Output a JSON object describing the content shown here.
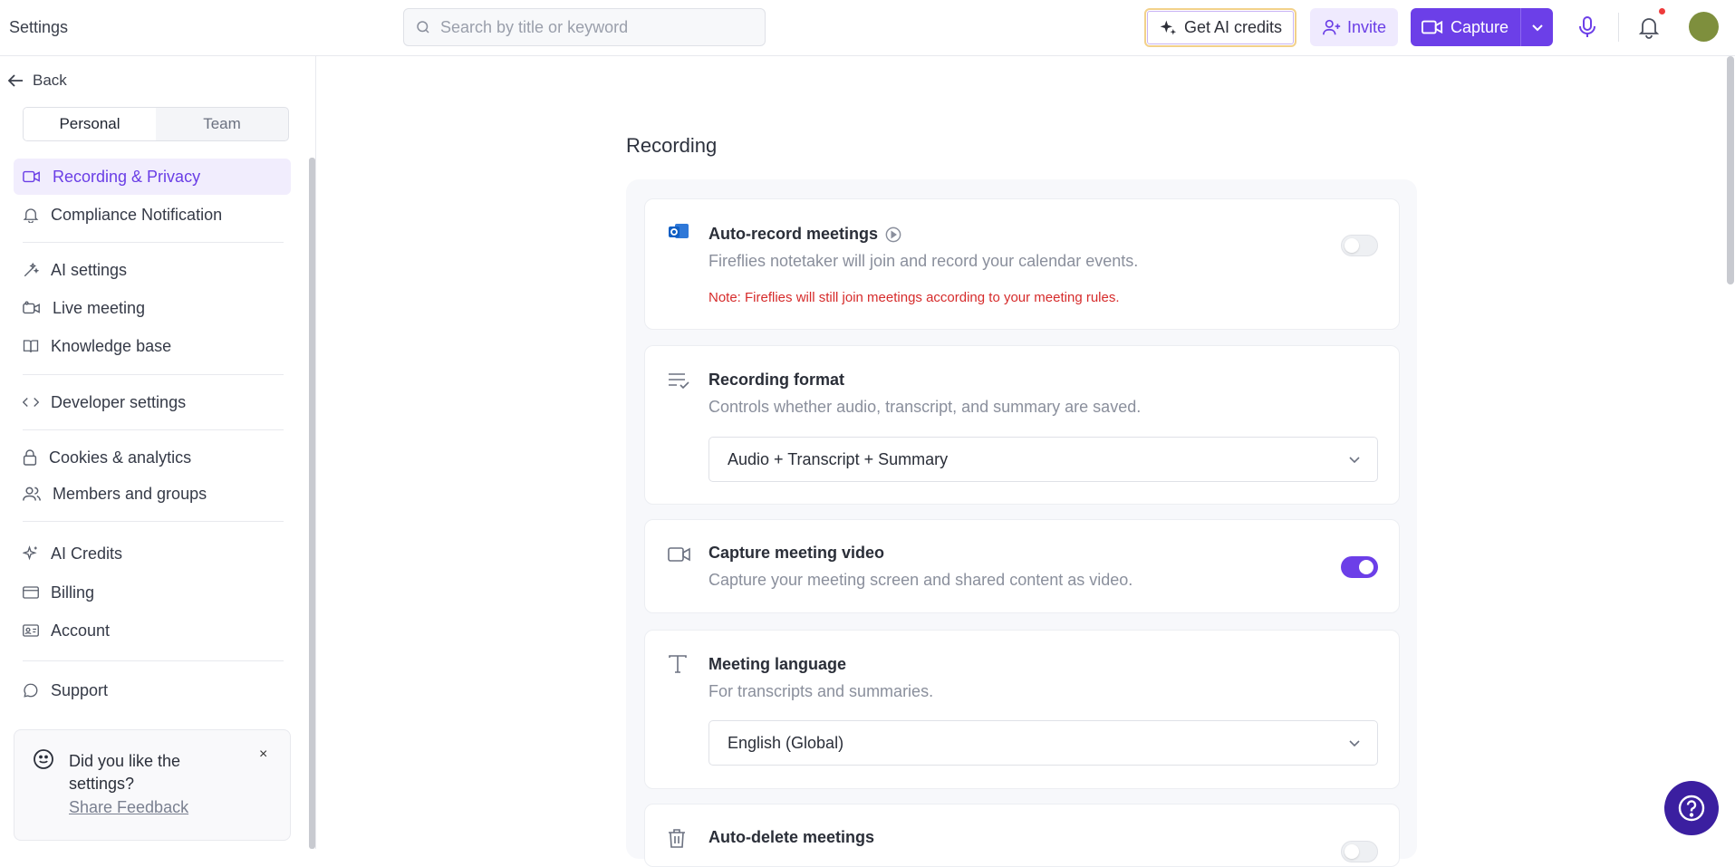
{
  "app": {
    "title": "Settings"
  },
  "search": {
    "placeholder": "Search by title or keyword"
  },
  "header": {
    "get_credits_label": "Get AI credits",
    "invite_label": "Invite",
    "capture_label": "Capture"
  },
  "sidebar": {
    "back_label": "Back",
    "segments": {
      "personal": "Personal",
      "team": "Team"
    },
    "items": [
      {
        "label": "Recording & Privacy",
        "icon": "video-icon",
        "active": true
      },
      {
        "label": "Compliance Notification",
        "icon": "bell-icon"
      },
      {
        "label": "AI settings",
        "icon": "magic-wand-icon"
      },
      {
        "label": "Live meeting",
        "icon": "live-video-icon"
      },
      {
        "label": "Knowledge base",
        "icon": "book-icon"
      },
      {
        "label": "Developer settings",
        "icon": "code-icon"
      },
      {
        "label": "Cookies & analytics",
        "icon": "lock-icon"
      },
      {
        "label": "Members and groups",
        "icon": "users-icon"
      },
      {
        "label": "AI Credits",
        "icon": "sparkle-icon"
      },
      {
        "label": "Billing",
        "icon": "credit-card-icon"
      },
      {
        "label": "Account",
        "icon": "id-card-icon"
      },
      {
        "label": "Support",
        "icon": "chat-icon"
      }
    ],
    "feedback": {
      "title": "Did you like the settings?",
      "link": "Share Feedback",
      "close": "×"
    }
  },
  "main": {
    "section_title": "Recording",
    "cards": {
      "auto_record": {
        "title": "Auto-record meetings",
        "desc": "Fireflies notetaker will join and record your calendar events.",
        "note": "Note: Fireflies will still join meetings according to your meeting rules.",
        "enabled": false
      },
      "format": {
        "title": "Recording format",
        "desc": "Controls whether audio, transcript, and summary are saved.",
        "selected": "Audio + Transcript + Summary"
      },
      "video": {
        "title": "Capture meeting video",
        "desc": "Capture your meeting screen and shared content as video.",
        "enabled": true
      },
      "language": {
        "title": "Meeting language",
        "desc": "For transcripts and summaries.",
        "selected": "English (Global)"
      },
      "auto_delete": {
        "title": "Auto-delete meetings",
        "enabled": false
      }
    }
  },
  "colors": {
    "accent": "#6c3fe8",
    "note": "#d62b2b",
    "help": "#3b1fa0"
  }
}
